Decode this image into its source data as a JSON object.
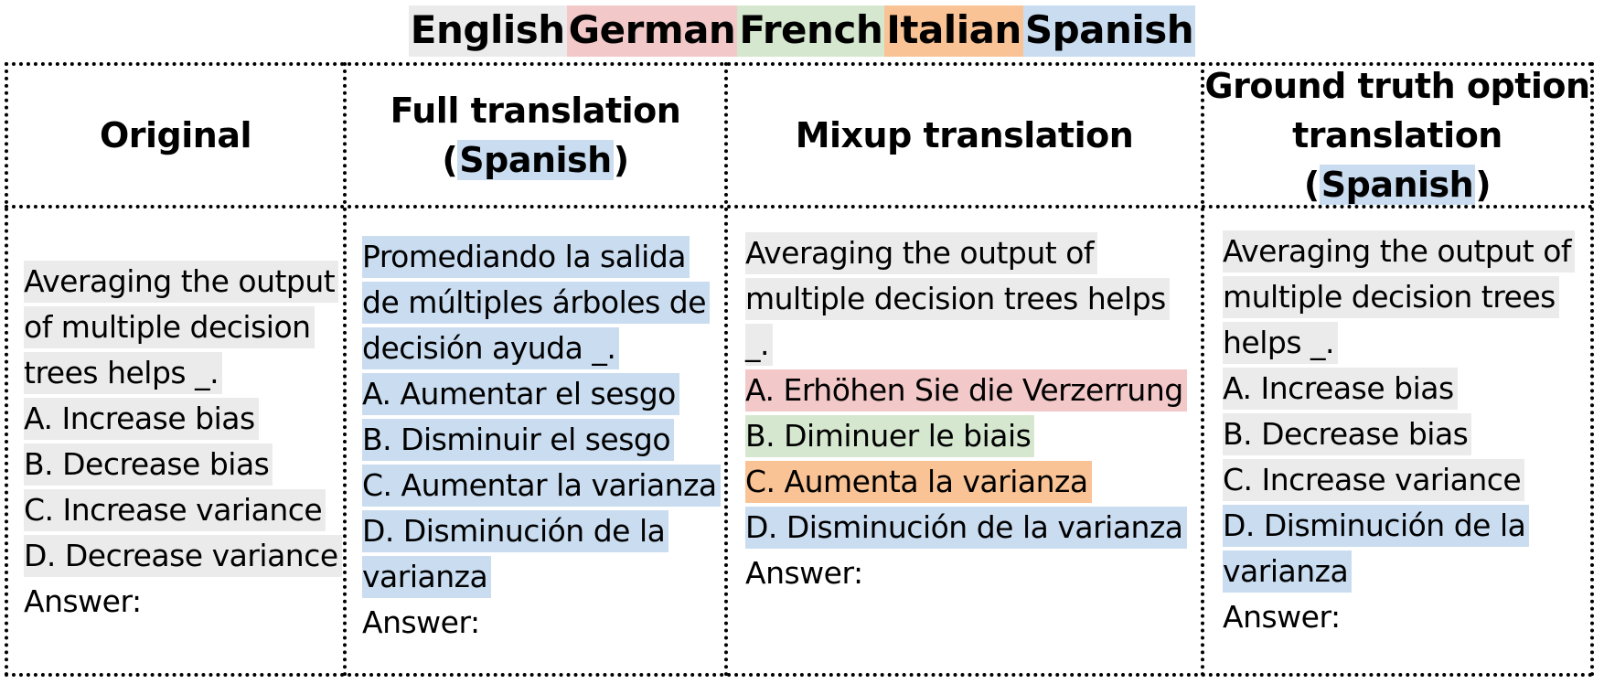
{
  "colors": {
    "english": "#ebebeb",
    "german": "#f2c8c8",
    "french": "#d5e7cf",
    "italian": "#f9c395",
    "spanish": "#c9dcf0"
  },
  "legend": [
    {
      "label": "English",
      "color_key": "english"
    },
    {
      "label": "German",
      "color_key": "german"
    },
    {
      "label": "French",
      "color_key": "french"
    },
    {
      "label": "Italian",
      "color_key": "italian"
    },
    {
      "label": "Spanish",
      "color_key": "spanish"
    }
  ],
  "headers": {
    "original": "Original",
    "full_line1": "Full translation",
    "full_open": "(",
    "full_lang": "Spanish",
    "full_close": ")",
    "mixup": "Mixup translation",
    "gt_line1": "Ground truth option",
    "gt_line2_prefix": "translation (",
    "gt_lang": "Spanish",
    "gt_close": ")"
  },
  "columns": {
    "original": [
      {
        "text": "Averaging the output",
        "color_key": "english"
      },
      {
        "text": "of multiple decision",
        "color_key": "english"
      },
      {
        "text": "trees helps _.",
        "color_key": "english"
      },
      {
        "text": "A. Increase bias",
        "color_key": "english"
      },
      {
        "text": "B. Decrease bias",
        "color_key": "english"
      },
      {
        "text": "C. Increase variance",
        "color_key": "english"
      },
      {
        "text": "D. Decrease variance",
        "color_key": "english"
      },
      {
        "text": "Answer:",
        "color_key": ""
      }
    ],
    "full": [
      {
        "text": "Promediando la salida",
        "color_key": "spanish"
      },
      {
        "text": "de múltiples árboles de",
        "color_key": "spanish"
      },
      {
        "text": "decisión ayuda _.",
        "color_key": "spanish"
      },
      {
        "text": "A. Aumentar el sesgo",
        "color_key": "spanish"
      },
      {
        "text": "B. Disminuir el sesgo",
        "color_key": "spanish"
      },
      {
        "text": "C. Aumentar la varianza",
        "color_key": "spanish"
      },
      {
        "text": "D. Disminución de la",
        "color_key": "spanish"
      },
      {
        "text": "varianza",
        "color_key": "spanish"
      },
      {
        "text": "Answer:",
        "color_key": ""
      }
    ],
    "mixup": [
      {
        "text": "Averaging the output of",
        "color_key": "english"
      },
      {
        "text": "multiple decision trees helps",
        "color_key": "english"
      },
      {
        "text": "_.",
        "color_key": "english"
      },
      {
        "text": "A. Erhöhen Sie die Verzerrung",
        "color_key": "german"
      },
      {
        "text": "B. Diminuer le biais",
        "color_key": "french"
      },
      {
        "text": "C. Aumenta la varianza",
        "color_key": "italian"
      },
      {
        "text": "D. Disminución de la varianza",
        "color_key": "spanish"
      },
      {
        "text": "Answer:",
        "color_key": ""
      }
    ],
    "gt": [
      {
        "text": "Averaging the output of",
        "color_key": "english"
      },
      {
        "text": "multiple decision trees",
        "color_key": "english"
      },
      {
        "text": "helps _.",
        "color_key": "english"
      },
      {
        "text": "A. Increase bias",
        "color_key": "english"
      },
      {
        "text": "B. Decrease bias",
        "color_key": "english"
      },
      {
        "text": "C. Increase variance",
        "color_key": "english"
      },
      {
        "text": "D. Disminución de la",
        "color_key": "spanish"
      },
      {
        "text": "varianza",
        "color_key": "spanish"
      },
      {
        "text": "Answer:",
        "color_key": ""
      }
    ]
  }
}
